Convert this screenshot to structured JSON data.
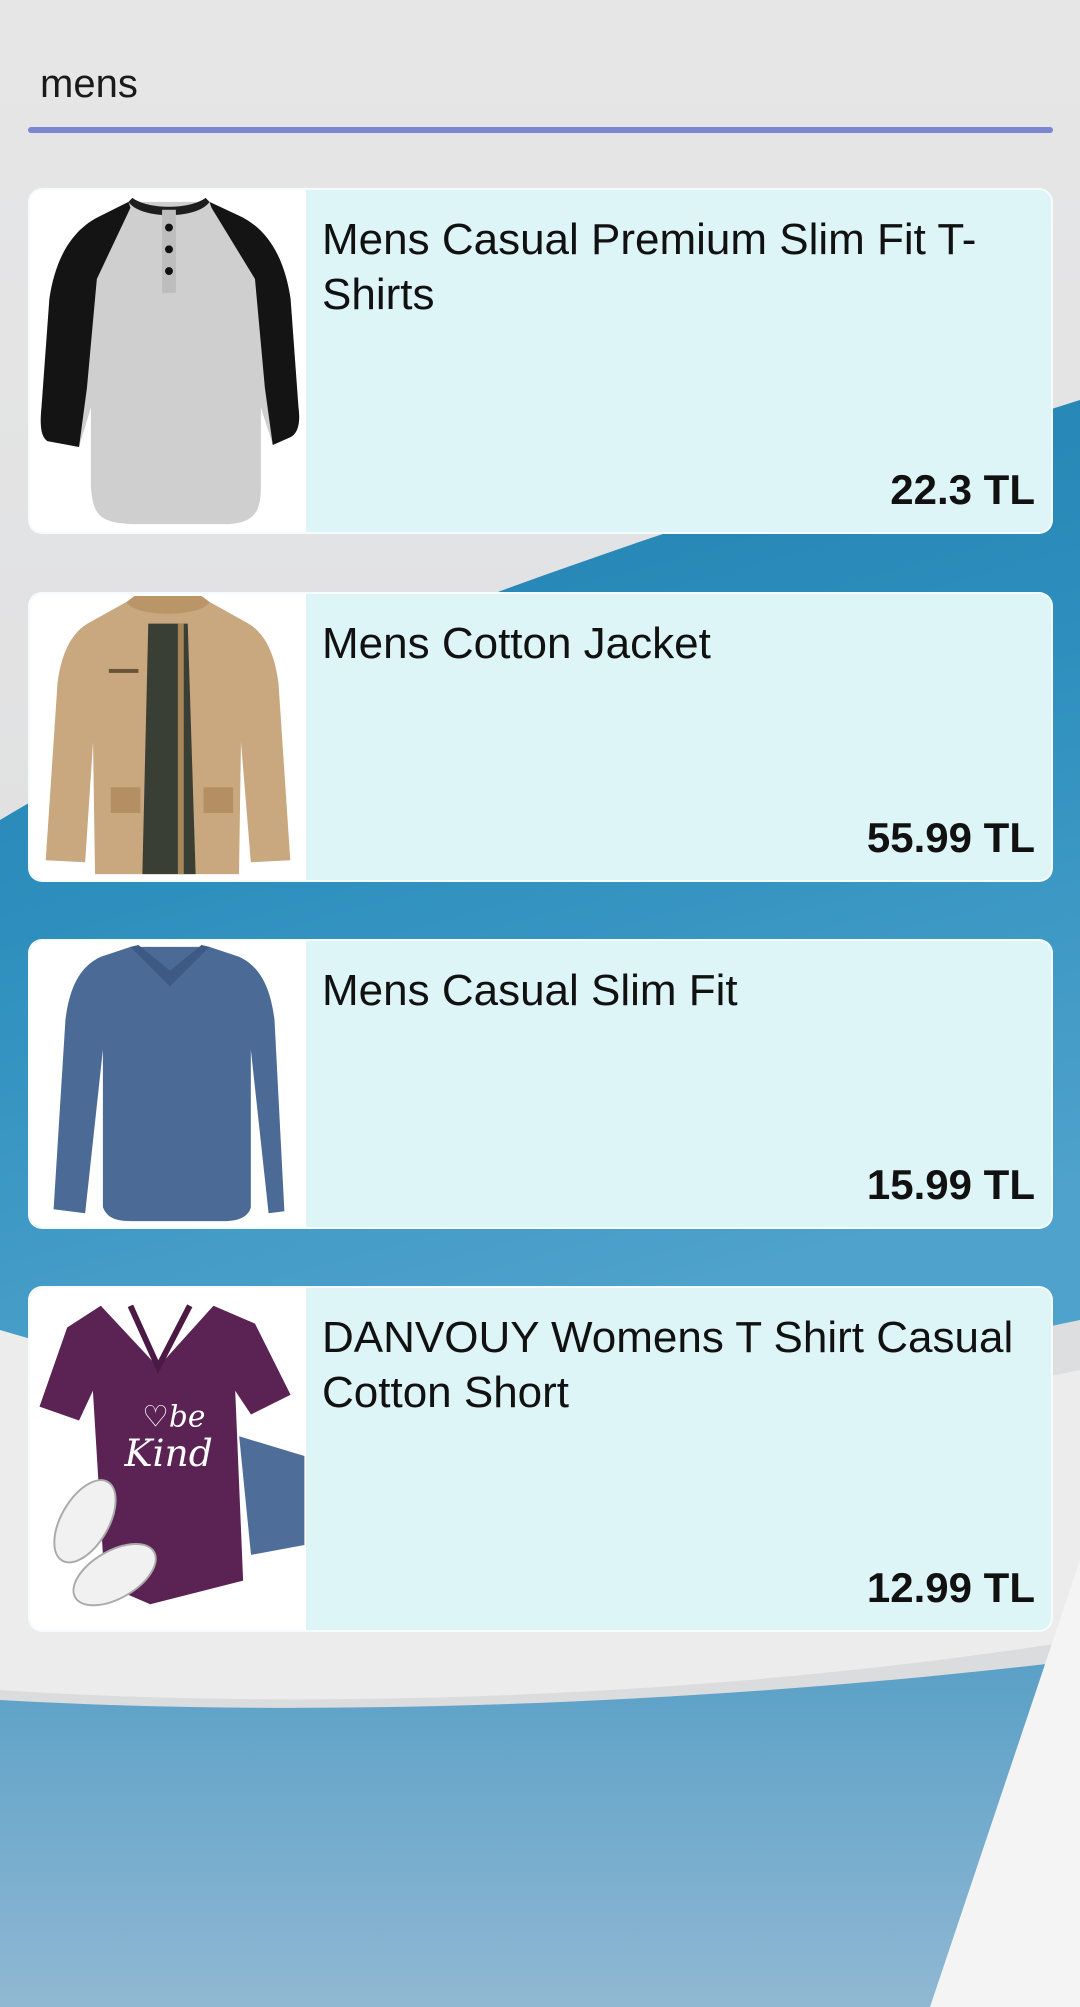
{
  "theme": {
    "accent": "#7b86cf",
    "card_bg": "#def5f8",
    "background_light": "#ededed",
    "background_blue": "#2b86b3"
  },
  "search": {
    "value": "mens"
  },
  "products": [
    {
      "title": "Mens Casual Premium Slim Fit T-Shirts",
      "price": "22.3 TL",
      "image": "raglan-henley-tshirt-image"
    },
    {
      "title": "Mens Cotton Jacket",
      "price": "55.99 TL",
      "image": "khaki-cotton-jacket-image"
    },
    {
      "title": "Mens Casual Slim Fit",
      "price": "15.99 TL",
      "image": "blue-long-sleeve-tshirt-image"
    },
    {
      "title": "DANVOUY Womens T Shirt Casual Cotton Short",
      "price": "12.99 TL",
      "image": "purple-be-kind-tshirt-image"
    }
  ]
}
